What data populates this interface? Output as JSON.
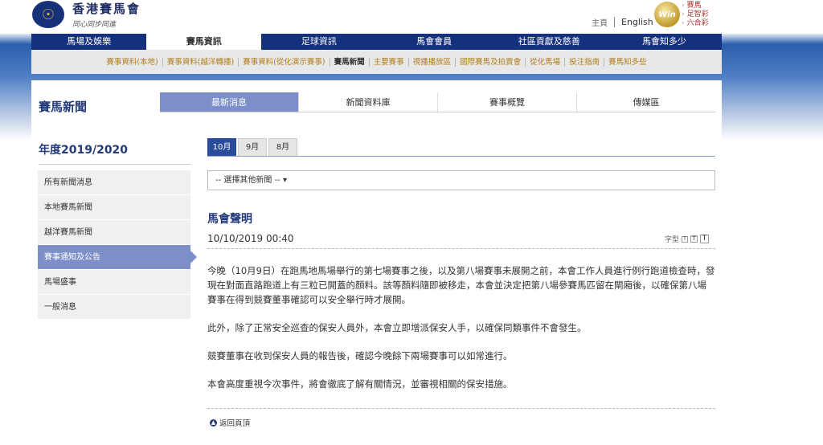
{
  "header": {
    "logo_name": "香港賽馬會",
    "logo_slogan": "同心同步同進",
    "links": [
      "主頁",
      "English"
    ],
    "win_logo_text": "Win",
    "win_products": [
      "賽馬",
      "足智彩",
      "六合彩"
    ]
  },
  "mainnav": {
    "items": [
      "馬場及娛樂",
      "賽馬資訊",
      "足球資訊",
      "馬會會員",
      "社區貢獻及慈善",
      "馬會知多少"
    ],
    "active_index": 1
  },
  "subnav": {
    "items": [
      "賽事資料(本地)",
      "賽事資料(越洋轉播)",
      "賽事資料(從化演示賽事)",
      "賽馬新聞",
      "主要賽事",
      "視播播放區",
      "國際賽馬及拍賣會",
      "從化馬場",
      "投注指南",
      "賽馬知多些"
    ],
    "active_index": 3
  },
  "section": {
    "title": "賽馬新聞",
    "tabs": [
      "最新消息",
      "新聞資料庫",
      "賽事概覽",
      "傳媒區"
    ]
  },
  "year": {
    "title": "年度2019/2020",
    "months": [
      "10月",
      "9月",
      "8月"
    ]
  },
  "sidebar": {
    "items": [
      "所有新聞消息",
      "本地賽馬新聞",
      "越洋賽馬新聞",
      "賽事通知及公告",
      "馬場盛事",
      "一般消息"
    ]
  },
  "dropdown": {
    "label": "-- 選擇其他新聞 --",
    "arrow": "▾"
  },
  "article": {
    "title": "馬會聲明",
    "date": "10/10/2019 00:40",
    "font_size_label": "字型",
    "font_size_glyph": "T",
    "paragraphs": [
      "今晚（10月9日）在跑馬地馬場舉行的第七場賽事之後，以及第八場賽事未展開之前，本會工作人員進行例行跑道檢查時，發現在對面直路跑道上有三粒已開蓋的顏料。該等顏料隨即被移走，本會並決定把第八場參賽馬匹留在閘廂後，以確保第八場賽事在得到競賽董事確認可以安全舉行時才展開。",
      "此外，除了正常安全巡查的保安人員外，本會立即增派保安人手，以確保同類事件不會發生。",
      "競賽董事在收到保安人員的報告後，確認今晚餘下兩場賽事可以如常進行。",
      "本會高度重視今次事件，將會徹底了解有關情況，並審視相關的保安措施。"
    ],
    "back_to_top": "返回頁頂",
    "back_icon_glyph": "▲"
  }
}
